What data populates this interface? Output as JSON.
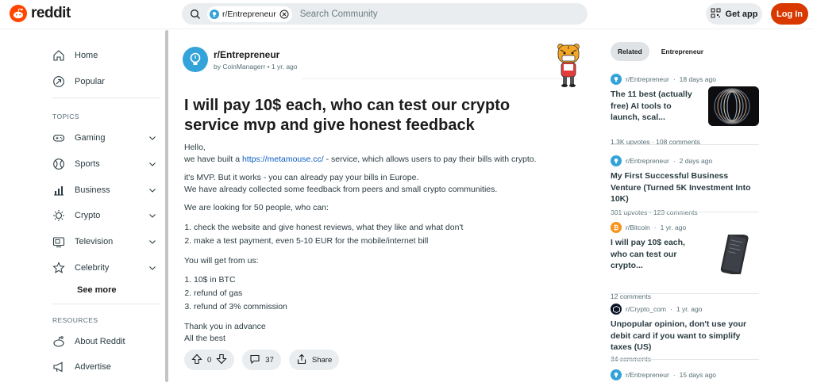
{
  "header": {
    "logo_text": "reddit",
    "search_chip": "r/Entrepreneur",
    "search_placeholder": "Search Community",
    "get_app": "Get app",
    "login": "Log In"
  },
  "sidebar": {
    "home": "Home",
    "popular": "Popular",
    "topics_label": "TOPICS",
    "topics": [
      "Gaming",
      "Sports",
      "Business",
      "Crypto",
      "Television",
      "Celebrity"
    ],
    "see_more": "See more",
    "resources_label": "RESOURCES",
    "resources": [
      "About Reddit",
      "Advertise"
    ]
  },
  "post": {
    "subreddit": "r/Entrepreneur",
    "author": "by CoinManagerr",
    "time": "1 yr. ago",
    "title": "I will pay 10$ each, who can test our crypto service mvp and give honest feedback",
    "greeting": "Hello,",
    "intro_pre": "we have built a ",
    "link": "https://metamouse.cc/",
    "intro_post": " - service, which allows users to pay their bills with crypto.",
    "mvp_line": "it's MVP. But it works - you can already pay your bills in Europe.",
    "feedback_line": "We have already collected some feedback from peers and small crypto communities.",
    "looking_line": "We are looking for 50 people, who can:",
    "tasks": [
      "check the website and give honest reviews, what they like and what don't",
      "make a test payment, even 5-10 EUR for the mobile/internet bill"
    ],
    "get_line": "You will get from us:",
    "rewards": [
      "10$ in BTC",
      "refund of gas",
      "refund of 3% commission"
    ],
    "thanks": "Thank you in advance",
    "best": "All the best",
    "votes": "0",
    "comments": "37",
    "share": "Share"
  },
  "right": {
    "tabs": [
      "Related",
      "Entrepreneur"
    ],
    "items": [
      {
        "sub": "r/Entrepreneur",
        "time": "18 days ago",
        "title": "The 11 best (actually free) AI tools to launch, scal...",
        "stats": "1.3K upvotes · 108 comments",
        "color": "#34a3d9"
      },
      {
        "sub": "r/Entrepreneur",
        "time": "2 days ago",
        "title": "My First Successful Business Venture (Turned 5K Investment Into 10K)",
        "stats": "301 upvotes · 123 comments",
        "color": "#34a3d9"
      },
      {
        "sub": "r/Bitcoin",
        "time": "1 yr. ago",
        "title": "I will pay 10$ each, who can test our crypto...",
        "stats": "12 comments",
        "color": "#f7931a"
      },
      {
        "sub": "r/Crypto_com",
        "time": "1 yr. ago",
        "title": "Unpopular opinion, don't use your debit card if you want to simplify taxes (US)",
        "stats": "34 comments",
        "color": "#0b1426"
      },
      {
        "sub": "r/Entrepreneur",
        "time": "15 days ago",
        "color": "#34a3d9"
      }
    ]
  }
}
